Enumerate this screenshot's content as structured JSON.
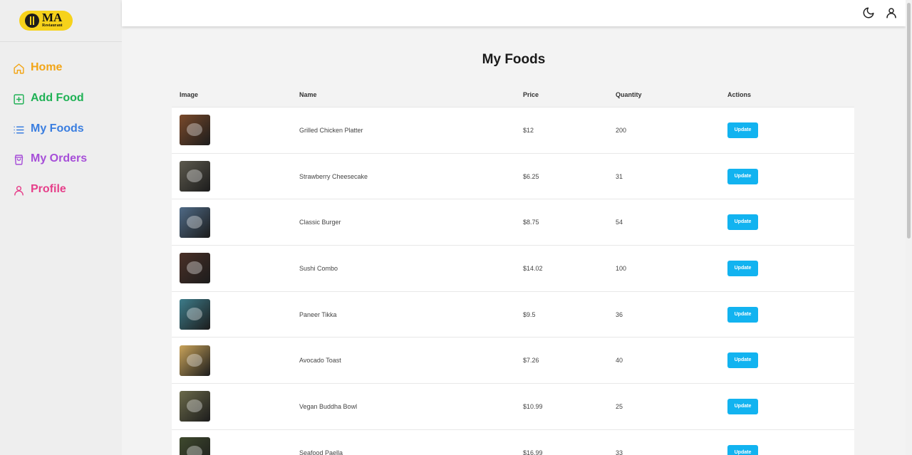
{
  "brand": {
    "logo_text": "MA",
    "logo_sub": "Restaurant"
  },
  "sidebar": {
    "items": [
      {
        "label": "Home",
        "icon": "home-icon",
        "color": "#f2a516"
      },
      {
        "label": "Add Food",
        "icon": "plus-square-icon",
        "color": "#1fb155"
      },
      {
        "label": "My Foods",
        "icon": "list-icon",
        "color": "#3a7ee0"
      },
      {
        "label": "My Orders",
        "icon": "shopping-bag-icon",
        "color": "#a64ed8"
      },
      {
        "label": "Profile",
        "icon": "user-icon",
        "color": "#e63f8a"
      }
    ]
  },
  "topbar": {
    "icons": [
      "moon-icon",
      "user-icon"
    ]
  },
  "page": {
    "title": "My Foods"
  },
  "table": {
    "headers": {
      "image": "Image",
      "name": "Name",
      "price": "Price",
      "quantity": "Quantity",
      "actions": "Actions"
    },
    "rows": [
      {
        "name": "Grilled Chicken Platter",
        "price": "$12",
        "quantity": "200",
        "action": "Update",
        "thumb_color": "#7a4a2b"
      },
      {
        "name": "Strawberry Cheesecake",
        "price": "$6.25",
        "quantity": "31",
        "action": "Update",
        "thumb_color": "#5d5a4e"
      },
      {
        "name": "Classic Burger",
        "price": "$8.75",
        "quantity": "54",
        "action": "Update",
        "thumb_color": "#4f6a86"
      },
      {
        "name": "Sushi Combo",
        "price": "$14.02",
        "quantity": "100",
        "action": "Update",
        "thumb_color": "#4a3027"
      },
      {
        "name": "Paneer Tikka",
        "price": "$9.5",
        "quantity": "36",
        "action": "Update",
        "thumb_color": "#3d7c8a"
      },
      {
        "name": "Avocado Toast",
        "price": "$7.26",
        "quantity": "40",
        "action": "Update",
        "thumb_color": "#c9a35a"
      },
      {
        "name": "Vegan Buddha Bowl",
        "price": "$10.99",
        "quantity": "25",
        "action": "Update",
        "thumb_color": "#6b6a4a"
      },
      {
        "name": "Seafood Paella",
        "price": "$16.99",
        "quantity": "33",
        "action": "Update",
        "thumb_color": "#3f4a2e"
      }
    ]
  },
  "colors": {
    "accent_button": "#12b3f0"
  }
}
